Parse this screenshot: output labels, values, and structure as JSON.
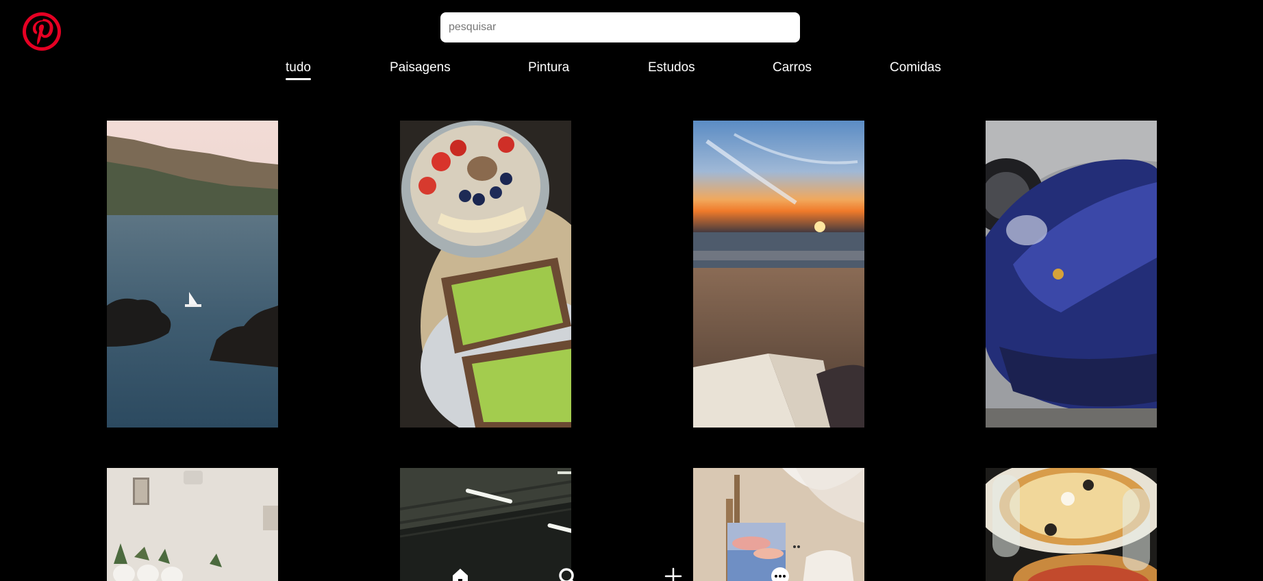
{
  "brand": {
    "logo_icon": "pinterest-logo-icon",
    "accent_color": "#e60023"
  },
  "search": {
    "placeholder": "pesquisar",
    "value": ""
  },
  "categories": [
    {
      "label": "tudo",
      "active": true
    },
    {
      "label": "Paisagens",
      "active": false
    },
    {
      "label": "Pintura",
      "active": false
    },
    {
      "label": "Estudos",
      "active": false
    },
    {
      "label": "Carros",
      "active": false
    },
    {
      "label": "Comidas",
      "active": false
    }
  ],
  "pins": [
    {
      "subject": "cliff-bay-sailboat-photo"
    },
    {
      "subject": "fruit-bowl-avocado-toast-photo"
    },
    {
      "subject": "beach-sunset-book-photo"
    },
    {
      "subject": "blue-sports-car-photo"
    },
    {
      "subject": "room-plants-wall-photo"
    },
    {
      "subject": "parking-garage-lights-photo"
    },
    {
      "subject": "easel-painting-room-photo"
    },
    {
      "subject": "pizza-wine-glasses-photo"
    }
  ],
  "bottom_nav": [
    {
      "icon": "home-icon"
    },
    {
      "icon": "search-icon"
    },
    {
      "icon": "plus-icon"
    },
    {
      "icon": "chat-bubble-icon"
    }
  ]
}
